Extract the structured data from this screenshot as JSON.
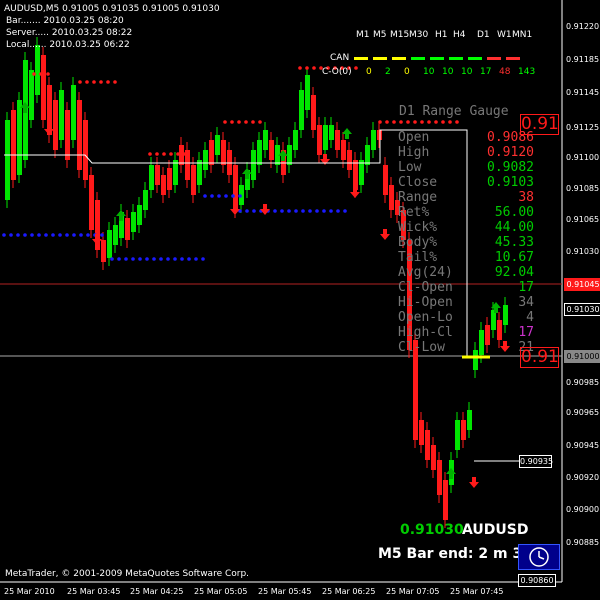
{
  "header": {
    "symbol_line": "AUDUSD,M5  0.91005 0.91035 0.91005 0.91030",
    "bar_line": "Bar....... 2010.03.25 08:20",
    "server_line": "Server..... 2010.03.25 08:22",
    "local_line": "Local...... 2010.03.25 06:22"
  },
  "timeframes": {
    "labels": [
      "M1",
      "M5",
      "M15",
      "M30",
      "H1",
      "H4",
      "D1",
      "W1",
      "MN1"
    ],
    "can_label": "CAN",
    "cmo_label": "C-O(0)",
    "cmo_values": [
      "0",
      "2",
      "0",
      "10",
      "10",
      "10",
      "17",
      "48",
      "143"
    ],
    "cmo_colors": [
      "#ffff00",
      "#00ff00",
      "#ffff00",
      "#00ff00",
      "#00ff00",
      "#00ff00",
      "#00ff00",
      "#ff3030",
      "#00ff00"
    ],
    "can_colors": [
      "#ffff00",
      "#ffff00",
      "#ffff00",
      "#00ff00",
      "#00ff00",
      "#00ff00",
      "#00ff00",
      "#ff3030",
      "#ff3030"
    ]
  },
  "gauge": {
    "title": "D1 Range Gauge",
    "rows": [
      {
        "label": "Open",
        "value": "0.9086",
        "color": "#ff3030"
      },
      {
        "label": "High",
        "value": "0.9120",
        "color": "#ff3030"
      },
      {
        "label": "Low",
        "value": "0.9082",
        "color": "#00cc00"
      },
      {
        "label": "Close",
        "value": "0.9103",
        "color": "#00cc00"
      },
      {
        "label": "Range",
        "value": "38",
        "color": "#ff3030"
      },
      {
        "label": "Ret%",
        "value": "56.00",
        "color": "#00cc00"
      },
      {
        "label": "Wick%",
        "value": "44.00",
        "color": "#00cc00"
      },
      {
        "label": "Body%",
        "value": "45.33",
        "color": "#00cc00"
      },
      {
        "label": "Tail%",
        "value": "10.67",
        "color": "#00cc00"
      },
      {
        "label": "Avg(24)",
        "value": "92.04",
        "color": "#00cc00"
      },
      {
        "label": "Cl-Open",
        "value": "17",
        "color": "#00cc00"
      },
      {
        "label": "Hi-Open",
        "value": "34",
        "color": "#777777"
      },
      {
        "label": "Open-Lo",
        "value": "4",
        "color": "#777777"
      },
      {
        "label": "High-Cl",
        "value": "17",
        "color": "#cc33cc"
      },
      {
        "label": "Cl-Low",
        "value": "21",
        "color": "#777777"
      }
    ],
    "marker_top": "0.91",
    "marker_bottom": "0.91"
  },
  "price_axis": {
    "labels": [
      "0.91220",
      "0.91185",
      "0.91145",
      "0.91125",
      "0.91100",
      "0.91085",
      "0.91065",
      "0.91030",
      "0.91000",
      "0.90985",
      "0.90965",
      "0.90945",
      "0.90920",
      "0.90900",
      "0.90885"
    ],
    "highlight_red": "0.91045",
    "highlight_current": "0.91030",
    "highlight_grey": "0.91000",
    "bottom_box": "0.90860",
    "level_box": "0.90935"
  },
  "time_axis": {
    "labels": [
      "25 Mar 2010",
      "25 Mar 03:45",
      "25 Mar 04:25",
      "25 Mar 05:05",
      "25 Mar 05:45",
      "25 Mar 06:25",
      "25 Mar 07:05",
      "25 Mar 07:45"
    ]
  },
  "footer": {
    "copyright": "MetaTrader, © 2001-2009 MetaQuotes Software Corp.",
    "price_big": "0.91030",
    "symbol_big": "AUDUSD",
    "bar_end": "M5 Bar end: 2 m 39 s"
  },
  "colors": {
    "bull": "#00e600",
    "bear": "#ff1a1a",
    "resistance_dots": "#ff1a1a",
    "support_dots": "#1a1aff",
    "background": "#000000"
  }
}
